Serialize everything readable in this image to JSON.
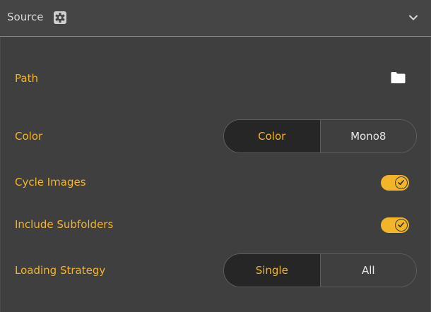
{
  "header": {
    "title": "Source",
    "settings_icon": "gear-icon",
    "collapse_icon": "chevron-down-icon"
  },
  "fields": {
    "path": {
      "label": "Path",
      "icon": "folder-icon"
    },
    "color": {
      "label": "Color",
      "options": [
        "Color",
        "Mono8"
      ],
      "selected": "Color"
    },
    "cycle_images": {
      "label": "Cycle Images",
      "checked": true
    },
    "include_subfolders": {
      "label": "Include Subfolders",
      "checked": true
    },
    "loading_strategy": {
      "label": "Loading Strategy",
      "options": [
        "Single",
        "All"
      ],
      "selected": "Single"
    }
  },
  "colors": {
    "accent": "#f2b52a",
    "panel_bg": "#3f3f3f",
    "header_bg": "#454545",
    "segment_active_bg": "#262626"
  }
}
